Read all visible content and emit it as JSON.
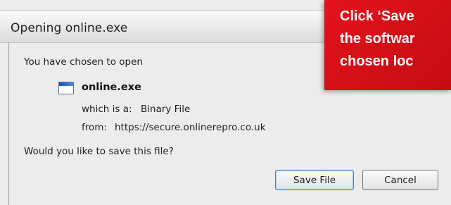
{
  "window": {
    "title": "Opening online.exe"
  },
  "dialog": {
    "intro": "You have chosen to open",
    "file_icon": "exe-file-icon",
    "filename": "online.exe",
    "type_label": "which is a:",
    "type_value": "Binary File",
    "from_label": "from:",
    "from_value": "https://secure.onlinerepro.co.uk",
    "question": "Would you like to save this file?"
  },
  "buttons": {
    "save": "Save File",
    "cancel": "Cancel"
  },
  "callout": {
    "lines": [
      "Click ‘Save",
      "the softwar",
      "chosen loc"
    ]
  },
  "colors": {
    "callout": "#d7141b",
    "default_button_border": "#3b7fcf"
  }
}
